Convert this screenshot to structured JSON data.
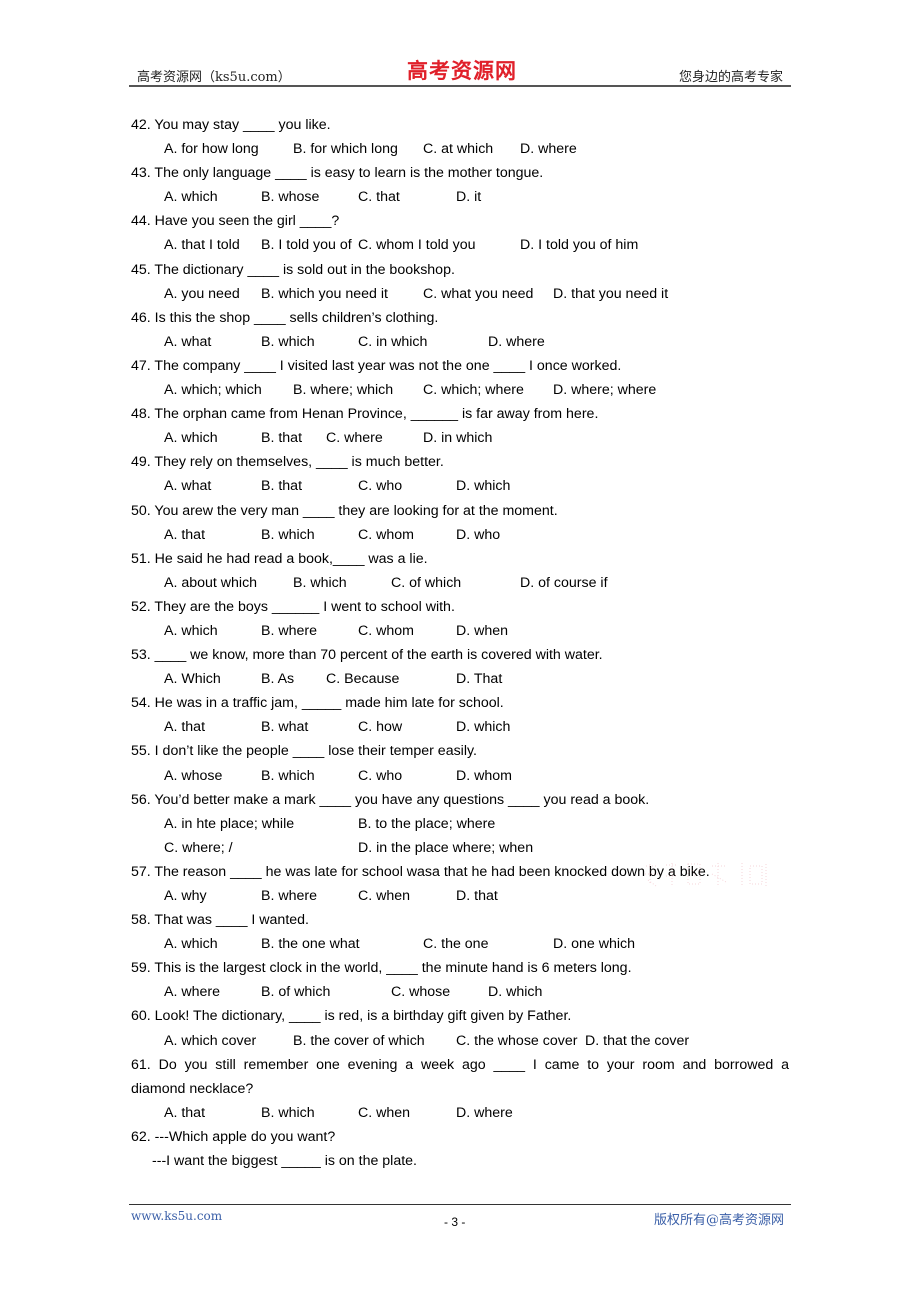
{
  "header": {
    "left": "高考资源网（ks5u.com）",
    "logo": "高考资源网",
    "right": "您身边的高考专家"
  },
  "questions": [
    {
      "stem": "42. You may stay ____ you like.",
      "options": [
        "A. for how long",
        "B. for which long",
        "C. at which",
        "D. where"
      ]
    },
    {
      "stem": "43. The only language ____ is easy to learn is the mother tongue.",
      "options": [
        "A. which",
        "B. whose",
        "C. that",
        "D. it"
      ]
    },
    {
      "stem": "44. Have you seen the girl ____?",
      "options": [
        "A. that I told",
        "B. I told you of",
        "C. whom I told you",
        "D. I told you of him"
      ]
    },
    {
      "stem": "45. The dictionary ____ is sold out in the bookshop.",
      "options": [
        "A. you need",
        "B. which you need it",
        "C. what you need",
        "D. that you need it"
      ]
    },
    {
      "stem": "46. Is this the shop ____ sells children’s clothing.",
      "options": [
        "A. what",
        "B. which",
        "C. in which",
        "D. where"
      ]
    },
    {
      "stem": "47. The company ____ I visited last year was not the one ____ I once worked.",
      "options": [
        "A. which; which",
        "B. where; which",
        "C. which; where",
        "D. where; where"
      ]
    },
    {
      "stem": "48. The orphan came from Henan Province, ______ is far away from here.",
      "options": [
        "A. which",
        "B. that",
        "C. where",
        "D. in which"
      ]
    },
    {
      "stem": "49. They rely on themselves, ____ is much better.",
      "options": [
        "A. what",
        "B. that",
        "C. who",
        "D. which"
      ]
    },
    {
      "stem": "50. You arew the very man ____ they are looking for at the moment.",
      "options": [
        "A. that",
        "B. which",
        "C. whom",
        "D. who"
      ]
    },
    {
      "stem": "51. He said he had read a book,____ was a lie.",
      "options": [
        "A. about which",
        "B. which",
        "C. of which",
        "D. of course if"
      ]
    },
    {
      "stem": "52. They are the boys ______ I went to school with.",
      "options": [
        "A. which",
        "B. where",
        "C. whom",
        "D. when"
      ]
    },
    {
      "stem": "53. ____ we know, more than 70 percent of the earth is covered with water.",
      "options": [
        "A. Which",
        "B. As",
        "C. Because",
        "D. That"
      ]
    },
    {
      "stem": "54. He was in a traffic jam, _____ made him late for school.",
      "options": [
        "A. that",
        "B. what",
        "C. how",
        "D. which"
      ]
    },
    {
      "stem": "55. I don’t like the people ____ lose their temper easily.",
      "options": [
        "A. whose",
        "B. which",
        "C. who",
        "D. whom"
      ]
    },
    {
      "stem": "56. You’d better make a mark ____ you have any questions ____ you read a book.",
      "options": [
        "A. in hte place; while",
        "B. to the place; where",
        "C. where; /",
        "D. in the place where; when"
      ]
    },
    {
      "stem": "57. The reason ____ he was late for school wasa that he had been knocked down by a bike.",
      "options": [
        "A. why",
        "B. where",
        "C. when",
        "D. that"
      ]
    },
    {
      "stem": "58. That was ____ I wanted.",
      "options": [
        "A. which",
        "B. the one what",
        "C. the one",
        "D. one which"
      ]
    },
    {
      "stem": "59. This is the largest clock in the world, ____ the minute hand is 6 meters long.",
      "options": [
        "A. where",
        "B. of which",
        "C. whose",
        "D. which"
      ]
    },
    {
      "stem": "60. Look! The dictionary, ____ is red, is a birthday gift given by Father.",
      "options": [
        "A. which cover",
        "B. the cover of which",
        "C. the whose cover",
        "D. that the cover"
      ]
    },
    {
      "stem_line1": "61. Do you still remember one evening a week ago ____ I came to your room and borrowed a",
      "stem_line2": "diamond necklace?",
      "options": [
        "A. that",
        "B. which",
        "C. when",
        "D. where"
      ]
    },
    {
      "stem": "62. ---Which apple do you want?",
      "answer_line": "---I want the biggest _____ is on the plate."
    }
  ],
  "footer": {
    "left": "www.ks5u.com",
    "page": "- 3 -",
    "right": "版权所有@高考资源网"
  }
}
